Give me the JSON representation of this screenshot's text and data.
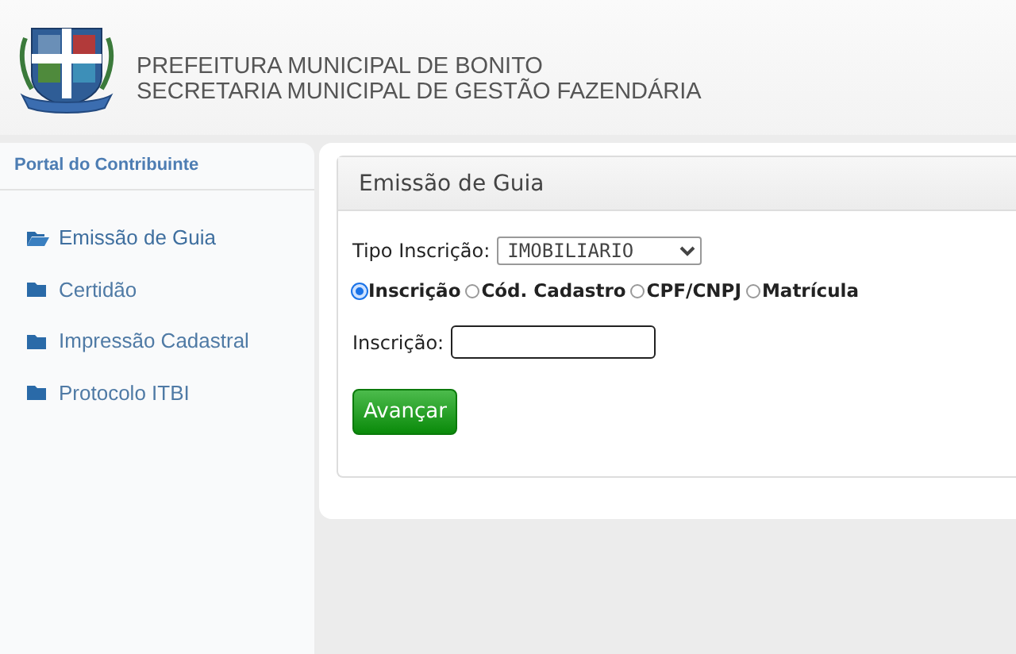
{
  "header": {
    "title_lines": [
      "PREFEITURA MUNICIPAL DE BONITO",
      "SECRETARIA MUNICIPAL DE GESTÃO FAZENDÁRIA"
    ]
  },
  "sidebar": {
    "title": "Portal do Contribuinte",
    "items": [
      {
        "label": "Emissão de Guia",
        "selected": true
      },
      {
        "label": "Certidão",
        "selected": false
      },
      {
        "label": "Impressão Cadastral",
        "selected": false
      },
      {
        "label": "Protocolo ITBI",
        "selected": false
      }
    ]
  },
  "panel": {
    "title": "Emissão de Guia",
    "type_field": {
      "label": "Tipo Inscrição:",
      "value": "IMOBILIARIO"
    },
    "search_by": [
      {
        "label": "Inscrição",
        "selected": true
      },
      {
        "label": "Cód. Cadastro",
        "selected": false
      },
      {
        "label": "CPF/CNPJ",
        "selected": false
      },
      {
        "label": "Matrícula",
        "selected": false
      }
    ],
    "input_field": {
      "label": "Inscrição:"
    },
    "button": "Avançar"
  }
}
